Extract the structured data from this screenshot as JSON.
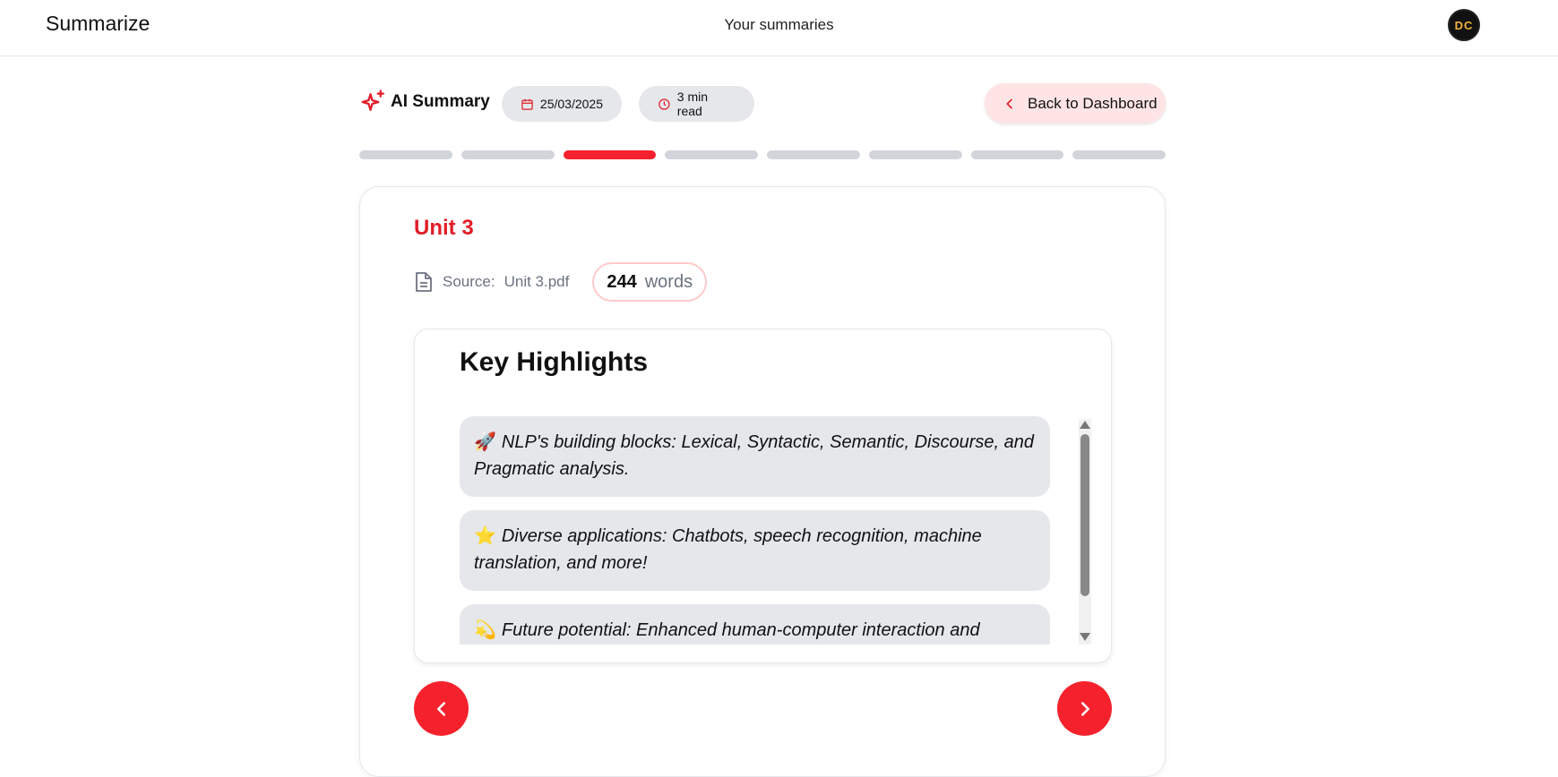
{
  "app": {
    "brand": "Summarize",
    "nav_link": "Your summaries",
    "avatar_initials": "DC"
  },
  "header": {
    "title": "AI Summary",
    "date": "25/03/2025",
    "read_time": "3 min read",
    "back_label": "Back to Dashboard"
  },
  "progress": {
    "total_steps": 8,
    "current_step": 3
  },
  "summary": {
    "title": "Unit 3",
    "source_label": "Source:",
    "source_file": "Unit 3.pdf",
    "word_count": "244",
    "word_unit": "words",
    "section_title": "Key Highlights",
    "highlights": [
      {
        "emoji": "🚀",
        "text": "NLP's building blocks: Lexical, Syntactic, Semantic, Discourse, and Pragmatic analysis."
      },
      {
        "emoji": "⭐",
        "text": "Diverse applications: Chatbots, speech recognition, machine translation, and more!"
      },
      {
        "emoji": "💫",
        "text": "Future potential: Enhanced human-computer interaction and improved"
      }
    ]
  },
  "colors": {
    "accent": "#f5222d",
    "accent_text": "#e11d28",
    "pill_bg": "#e5e7eb",
    "back_bg": "#ffe4e6"
  },
  "icons": {
    "sparkle": "sparkle-icon",
    "calendar": "calendar-icon",
    "clock": "clock-icon",
    "back": "chevron-left-icon",
    "document": "document-icon",
    "prev": "chevron-left-icon",
    "next": "chevron-right-icon"
  }
}
